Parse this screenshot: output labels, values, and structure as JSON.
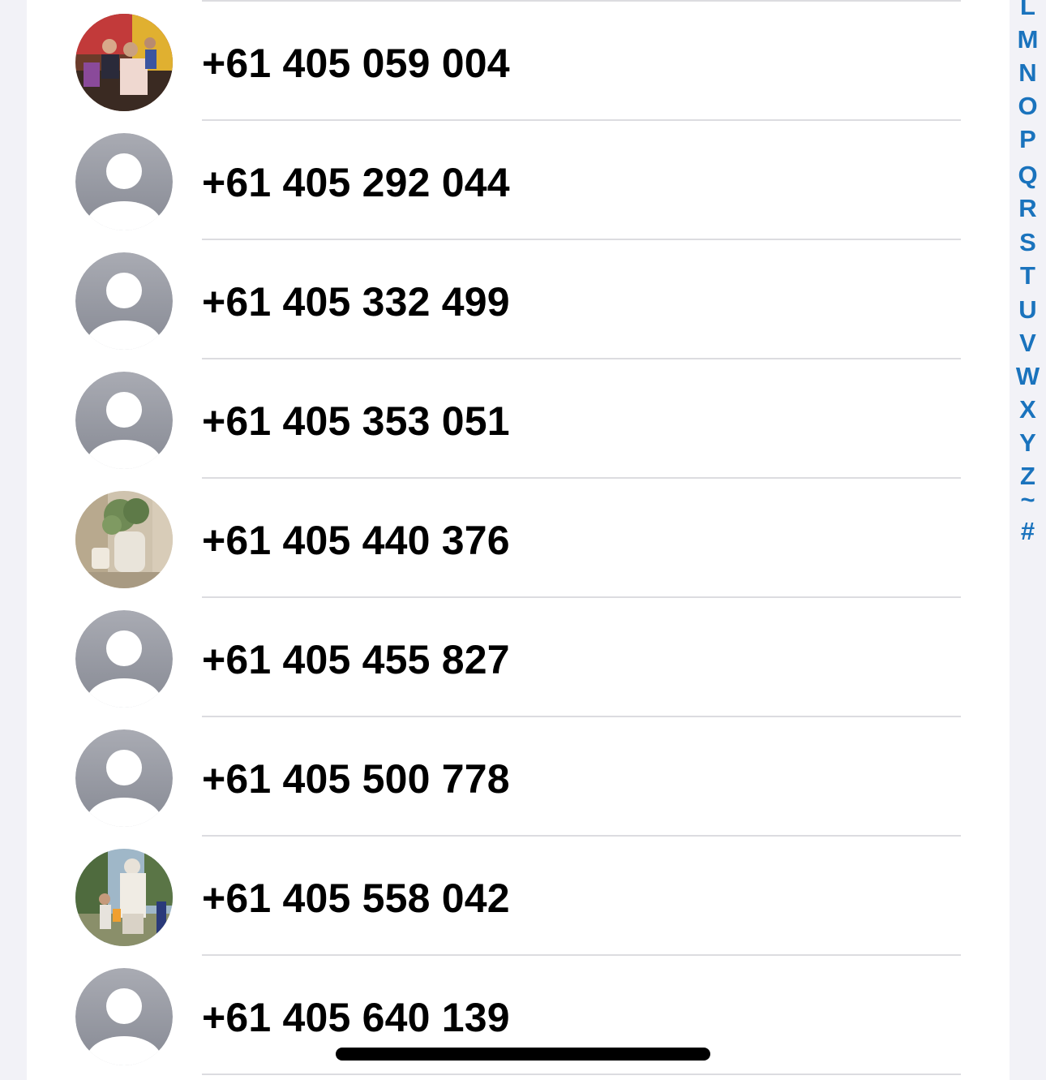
{
  "contacts": [
    {
      "phone": "+61 405 059 004",
      "avatar": "photo-family"
    },
    {
      "phone": "+61 405 292 044",
      "avatar": "placeholder"
    },
    {
      "phone": "+61 405 332 499",
      "avatar": "placeholder"
    },
    {
      "phone": "+61 405 353 051",
      "avatar": "placeholder"
    },
    {
      "phone": "+61 405 440 376",
      "avatar": "photo-plant"
    },
    {
      "phone": "+61 405 455 827",
      "avatar": "placeholder"
    },
    {
      "phone": "+61 405 500 778",
      "avatar": "placeholder"
    },
    {
      "phone": "+61 405 558 042",
      "avatar": "photo-statue"
    },
    {
      "phone": "+61 405 640 139",
      "avatar": "placeholder"
    }
  ],
  "index_letters": [
    "L",
    "M",
    "N",
    "O",
    "P",
    "Q",
    "R",
    "S",
    "T",
    "U",
    "V",
    "W",
    "X",
    "Y",
    "Z",
    "~",
    "#"
  ],
  "colors": {
    "index_accent": "#1a73bd",
    "background": "#f2f2f7",
    "placeholder_avatar": "#a3a5ad"
  }
}
